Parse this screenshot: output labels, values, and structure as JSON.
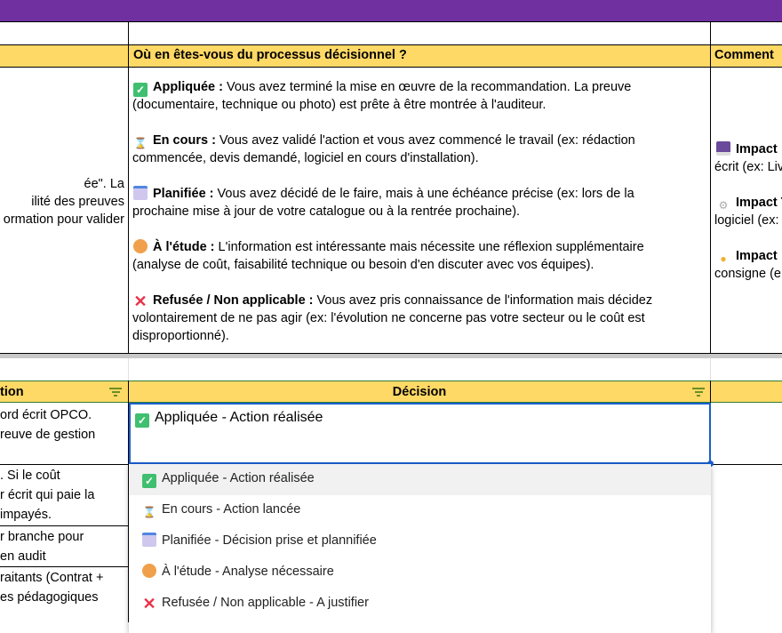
{
  "colors": {
    "header_bar": "#7030a0",
    "header_fill": "#ffd966",
    "selection": "#1a5fd0"
  },
  "top_table": {
    "headers": [
      "Où en êtes-vous du processus décisionnel ?",
      "Comment"
    ],
    "left_fragments": [
      "ée\". La",
      "ilité des preuves",
      "ormation pour valider"
    ],
    "statuses": [
      {
        "icon": "check-icon",
        "label": "Appliquée :",
        "lines": [
          " Vous avez terminé la mise en œuvre de la recommandation. La preuve",
          "(documentaire, technique ou photo) est prête à être montrée à l'auditeur."
        ]
      },
      {
        "icon": "hourglass-icon",
        "label": "En cours :",
        "lines": [
          " Vous avez validé l'action et vous avez commencé le travail (ex: rédaction",
          "commencée, devis demandé, logiciel en cours d'installation)."
        ]
      },
      {
        "icon": "calendar-icon",
        "label": "Planifiée :",
        "lines": [
          " Vous avez décidé de le faire, mais à une échéance précise (ex: lors de la",
          "prochaine mise à jour de votre catalogue ou à la rentrée prochaine)."
        ]
      },
      {
        "icon": "thinking-face-icon",
        "label": "À l'étude :",
        "lines": [
          " L'information est intéressante mais nécessite une réflexion supplémentaire",
          "(analyse de coût, faisabilité technique ou besoin d'en discuter avec vos équipes)."
        ]
      },
      {
        "icon": "cross-icon",
        "label": "Refusée / Non applicable :",
        "lines": [
          " Vous avez pris connaissance de l'information mais décidez",
          "volontairement de ne pas agir (ex: l'évolution ne concerne pas votre secteur ou le coût est",
          "disproportionné)."
        ]
      }
    ],
    "impacts": [
      {
        "icon": "floppy-disk-icon",
        "label": "Impact",
        "line2": "écrit (ex: Liv"
      },
      {
        "icon": "gear-icon",
        "label": "Impact T",
        "line2": "logiciel (ex:"
      },
      {
        "icon": "handshake-icon",
        "label": "Impact",
        "line2": "consigne (e"
      }
    ]
  },
  "bottom_table": {
    "headers": [
      "tion",
      "Décision"
    ],
    "left_rows": [
      [
        "ord écrit OPCO.",
        "reuve de gestion"
      ],
      [
        ". Si le coût",
        "r écrit qui paie la",
        " impayés."
      ],
      [
        "r branche pour",
        " en audit"
      ],
      [
        "raitants (Contrat +",
        "es pédagogiques"
      ]
    ],
    "cell_value": "Appliquée - Action réalisée",
    "dropdown": [
      {
        "icon": "check-icon",
        "label": "Appliquée - Action réalisée",
        "selected": true
      },
      {
        "icon": "hourglass-icon",
        "label": "En cours - Action lancée"
      },
      {
        "icon": "calendar-icon",
        "label": "Planifiée - Décision prise et plannifiée"
      },
      {
        "icon": "thinking-face-icon",
        "label": "À l'étude - Analyse nécessaire"
      },
      {
        "icon": "cross-icon",
        "label": "Refusée / Non applicable - A justifier"
      }
    ]
  }
}
